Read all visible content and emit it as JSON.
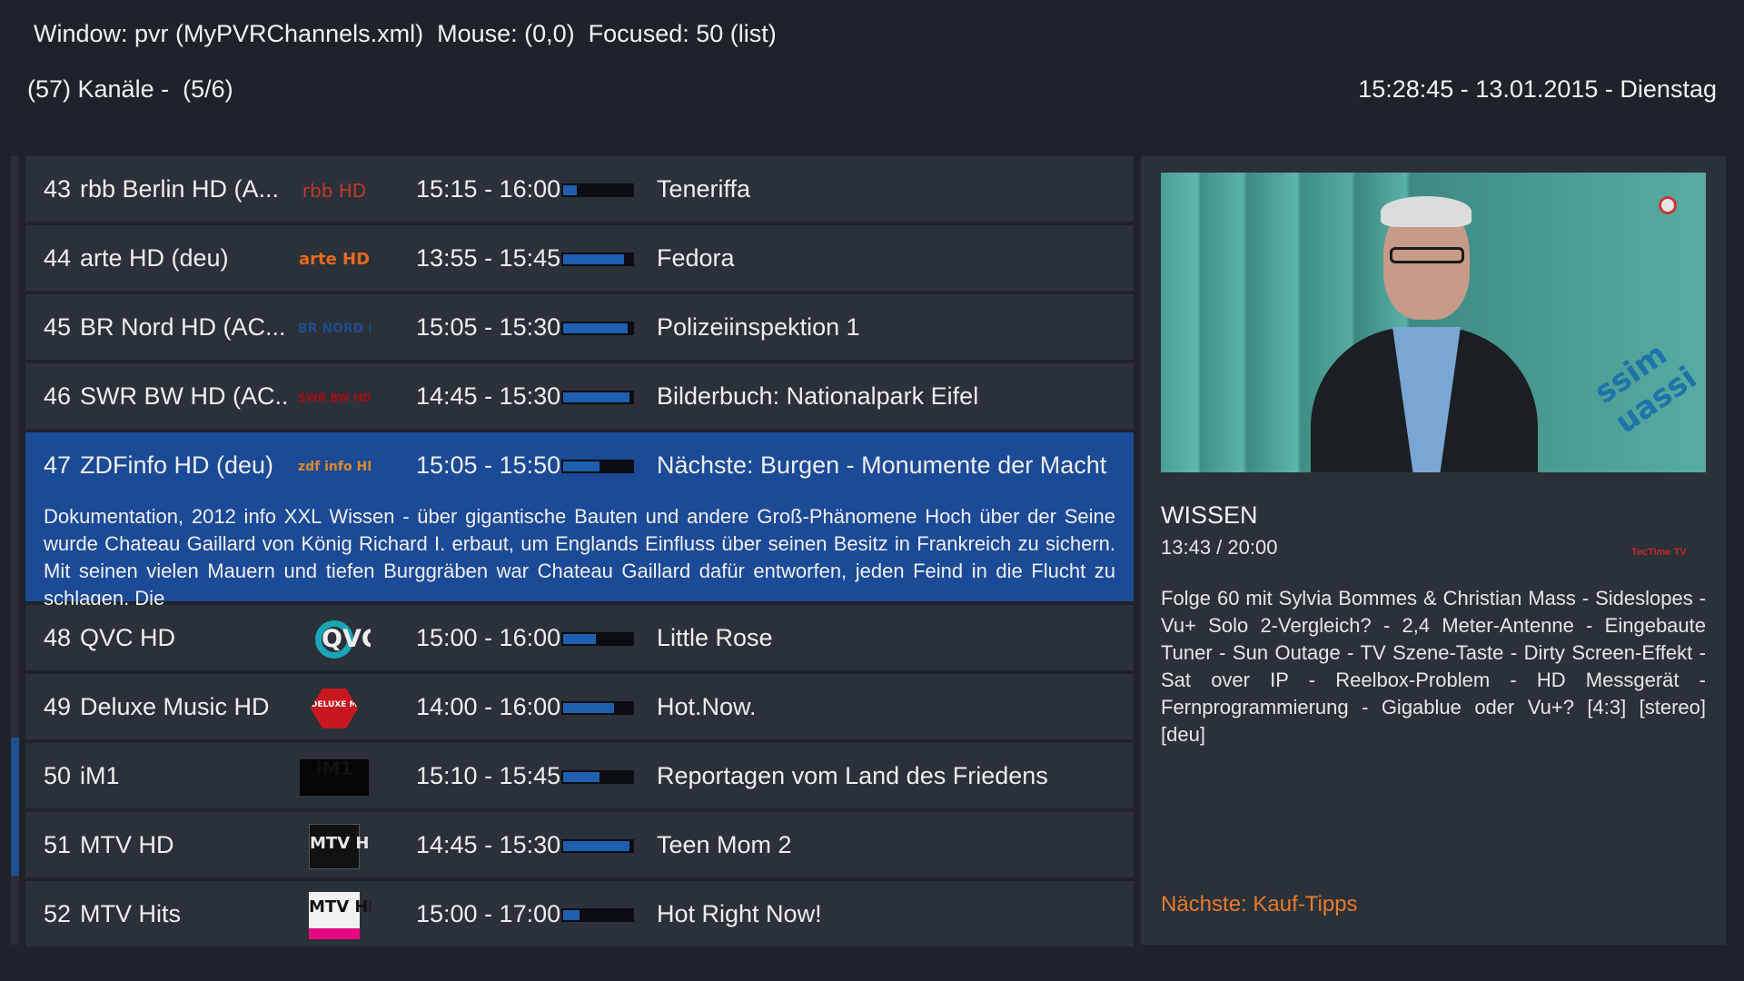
{
  "debug": {
    "text": "Window: pvr (MyPVRChannels.xml)  Mouse: (0,0)  Focused: 50 (list)"
  },
  "header": {
    "left": "(57) Kanäle -  (5/6)",
    "right": "15:28:45 - 13.01.2015 - Dienstag"
  },
  "colors": {
    "accent": "#1b4a96",
    "progress": "#1f5fb0",
    "next_show": "#e87a2c"
  },
  "channels": [
    {
      "num": "43",
      "name": "rbb Berlin HD (A...",
      "logo": "rbb",
      "logo_text": "rbb HD",
      "time": "15:15 - 16:00",
      "progress": 0.2,
      "title": "Teneriffa"
    },
    {
      "num": "44",
      "name": "arte HD (deu)",
      "logo": "arte",
      "logo_text": "arte HD",
      "time": "13:55 - 15:45",
      "progress": 0.88,
      "title": "Fedora"
    },
    {
      "num": "45",
      "name": "BR Nord HD (AC...",
      "logo": "br",
      "logo_text": "BR NORD HD",
      "time": "15:05 - 15:30",
      "progress": 0.93,
      "title": "Polizeiinspektion 1"
    },
    {
      "num": "46",
      "name": "SWR BW HD (AC...",
      "logo": "swr",
      "logo_text": "SWR BW HD",
      "time": "14:45 - 15:30",
      "progress": 0.96,
      "title": "Bilderbuch: Nationalpark Eifel"
    },
    {
      "num": "47",
      "name": "ZDFinfo HD (deu)",
      "logo": "zdf",
      "logo_text": "zdf info HD",
      "time": "15:05 - 15:50",
      "progress": 0.52,
      "title": "Nächste: Burgen - Monumente der Macht",
      "selected": true,
      "description": "Dokumentation, 2012 info XXL Wissen - über gigantische Bauten und andere Groß-Phänomene Hoch über der Seine wurde Chateau Gaillard von König Richard I. erbaut, um Englands Einfluss über seinen Besitz in Frankreich zu sichern. Mit seinen vielen Mauern und tiefen Burggräben war Chateau Gaillard dafür entworfen, jeden Feind in die Flucht zu schlagen. Die"
    },
    {
      "num": "48",
      "name": "QVC HD",
      "logo": "qvc",
      "logo_text": "QVC HD",
      "time": "15:00 - 16:00",
      "progress": 0.48,
      "title": "Little Rose"
    },
    {
      "num": "49",
      "name": "Deluxe Music HD",
      "logo": "deluxe",
      "logo_text": "DELUXE MUSIC HD",
      "time": "14:00 - 16:00",
      "progress": 0.74,
      "title": "Hot.Now."
    },
    {
      "num": "50",
      "name": "iM1",
      "logo": "im1",
      "logo_text": "iM1",
      "time": "15:10 - 15:45",
      "progress": 0.53,
      "title": "Reportagen vom Land des Friedens"
    },
    {
      "num": "51",
      "name": "MTV HD",
      "logo": "mtv",
      "logo_text": "MTV HD",
      "time": "14:45 - 15:30",
      "progress": 0.96,
      "title": "Teen Mom 2"
    },
    {
      "num": "52",
      "name": "MTV Hits",
      "logo": "mtvhits",
      "logo_text": "MTV HITS",
      "time": "15:00 - 17:00",
      "progress": 0.24,
      "title": "Hot Right Now!"
    }
  ],
  "info": {
    "preview_overlay": "ssim uassi",
    "genre": "WISSEN",
    "timeinfo": "13:43 / 20:00",
    "badge": "TecTime TV",
    "description": "Folge 60 mit Sylvia Bommes & Christian Mass - Sideslopes - Vu+ Solo 2-Vergleich? - 2,4 Meter-Antenne - Eingebaute Tuner - Sun Outage - TV Szene-Taste - Dirty Screen-Effekt - Sat over IP - Reelbox-Problem - HD Messgerät - Fernprogrammierung - Gigablue oder Vu+? [4:3] [stereo] [deu]",
    "next": "Nächste: Kauf-Tipps"
  },
  "scroll": {
    "position": 0.74
  }
}
